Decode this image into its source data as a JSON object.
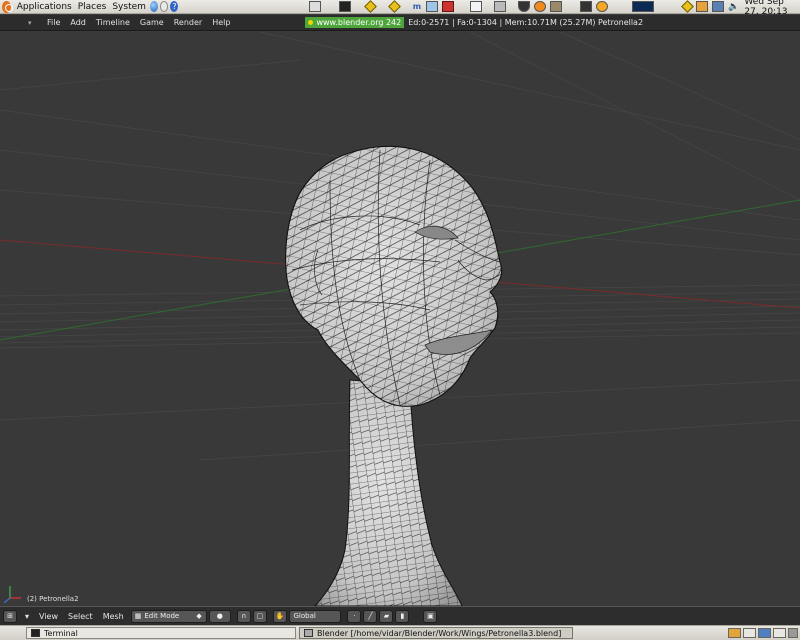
{
  "top_panel": {
    "menus": [
      "Applications",
      "Places",
      "System"
    ],
    "clock": "Wed Sep 27, 20:13"
  },
  "blender": {
    "menus": [
      "File",
      "Add",
      "Timeline",
      "Game",
      "Render",
      "Help"
    ],
    "url": "www.blender.org 242",
    "stats": "Ed:0-2571 | Fa:0-1304 | Mem:10.71M (25.27M) Petronella2"
  },
  "viewport": {
    "object_label": "(2) Petronella2"
  },
  "view3d_header": {
    "menus": [
      "View",
      "Select",
      "Mesh"
    ],
    "mode": "Edit Mode",
    "orientation": "Global"
  },
  "taskbar": {
    "tasks": [
      "Terminal",
      "Blender [/home/vidar/Blender/Work/Wings/Petronella3.blend]"
    ]
  },
  "colors": {
    "url_green": "#4ea53c",
    "viewport_bg": "#393939",
    "mesh_fill": "#c9c9c9"
  }
}
